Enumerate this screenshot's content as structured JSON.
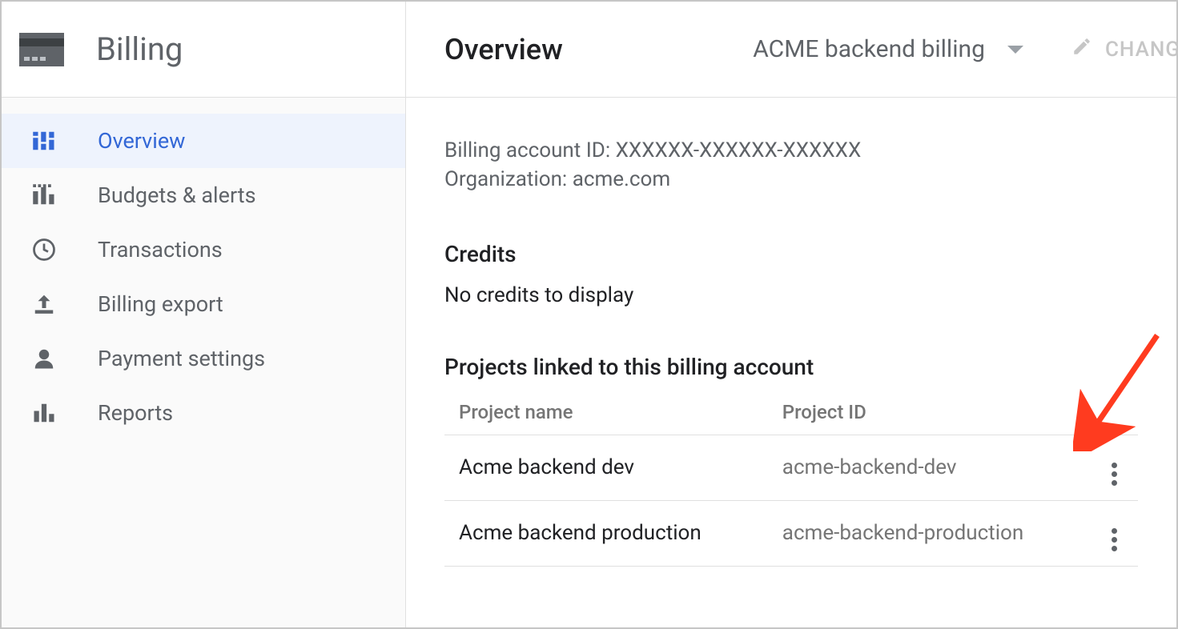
{
  "sidebar": {
    "title": "Billing",
    "items": [
      {
        "label": "Overview"
      },
      {
        "label": "Budgets & alerts"
      },
      {
        "label": "Transactions"
      },
      {
        "label": "Billing export"
      },
      {
        "label": "Payment settings"
      },
      {
        "label": "Reports"
      }
    ]
  },
  "header": {
    "title": "Overview",
    "account_name": "ACME backend billing",
    "change_label": "CHANG"
  },
  "info": {
    "billing_id_label": "Billing account ID: ",
    "billing_id_value": "XXXXXX-XXXXXX-XXXXXX",
    "org_label": "Organization: ",
    "org_value": "acme.com"
  },
  "credits": {
    "title": "Credits",
    "empty": "No credits to display"
  },
  "projects": {
    "title": "Projects linked to this billing account",
    "col_name": "Project name",
    "col_id": "Project ID",
    "rows": [
      {
        "name": "Acme backend dev",
        "id": "acme-backend-dev"
      },
      {
        "name": "Acme backend production",
        "id": "acme-backend-production"
      }
    ]
  }
}
